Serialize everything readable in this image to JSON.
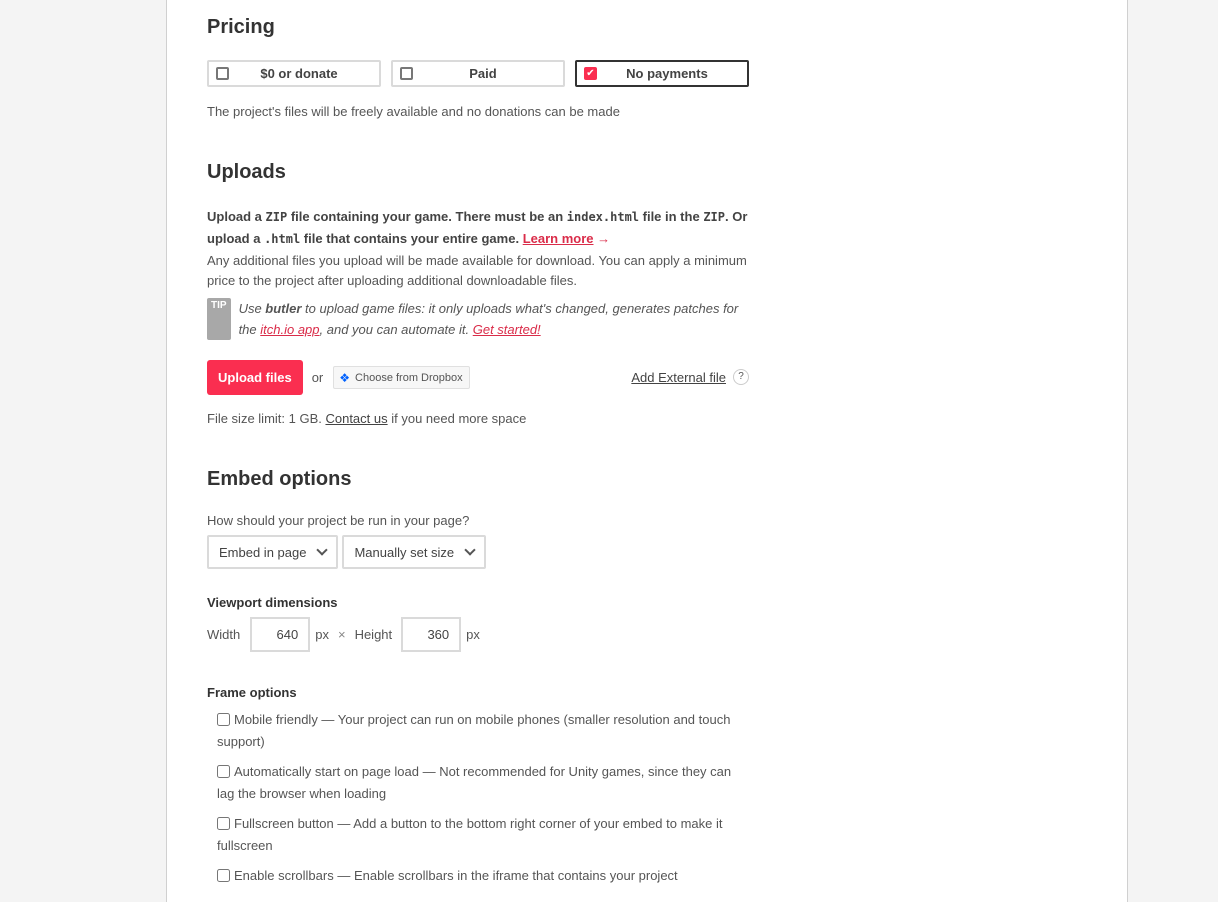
{
  "pricing": {
    "title": "Pricing",
    "options": [
      {
        "label": "$0 or donate",
        "selected": false
      },
      {
        "label": "Paid",
        "selected": false
      },
      {
        "label": "No payments",
        "selected": true
      }
    ],
    "description": "The project's files will be freely available and no donations can be made"
  },
  "uploads": {
    "title": "Uploads",
    "intro_1": "Upload a ",
    "intro_code_1": "ZIP",
    "intro_2": " file containing your game. There must be an ",
    "intro_code_2": "index.html",
    "intro_3": " file in the ",
    "intro_code_3": "ZIP",
    "intro_4": ". Or upload a ",
    "intro_code_4": ".html",
    "intro_5": " file that contains your entire game. ",
    "learn_more": "Learn more",
    "arrow": "→",
    "additional": "Any additional files you upload will be made available for download. You can apply a minimum price to the project after uploading additional downloadable files.",
    "tip_badge": "TIP",
    "tip_1": "Use ",
    "tip_butler": "butler",
    "tip_2": " to upload game files: it only uploads what's changed, generates patches for the ",
    "tip_app_link": "itch.io app",
    "tip_3": ", and you can automate it. ",
    "tip_get_started": "Get started!",
    "upload_button": "Upload files",
    "or": "or",
    "dropbox_button": "Choose from Dropbox",
    "add_external": "Add External file",
    "help": "?",
    "size_limit_1": "File size limit: 1 GB. ",
    "contact_us": "Contact us",
    "size_limit_2": " if you need more space"
  },
  "embed": {
    "title": "Embed options",
    "question": "How should your project be run in your page?",
    "mode_select": "Embed in page",
    "size_select": "Manually set size",
    "viewport_label": "Viewport dimensions",
    "width_label": "Width",
    "width_value": "640",
    "unit": "px",
    "times": "×",
    "height_label": "Height",
    "height_value": "360",
    "frame_label": "Frame options",
    "frame_options": [
      {
        "label": "Mobile friendly — Your project can run on mobile phones (smaller resolution and touch support)",
        "checked": false
      },
      {
        "label": "Automatically start on page load — Not recommended for Unity games, since they can lag the browser when loading",
        "checked": false
      },
      {
        "label": "Fullscreen button — Add a button to the bottom right corner of your embed to make it fullscreen",
        "checked": false
      },
      {
        "label": "Enable scrollbars — Enable scrollbars in the iframe that contains your project",
        "checked": false
      }
    ]
  }
}
